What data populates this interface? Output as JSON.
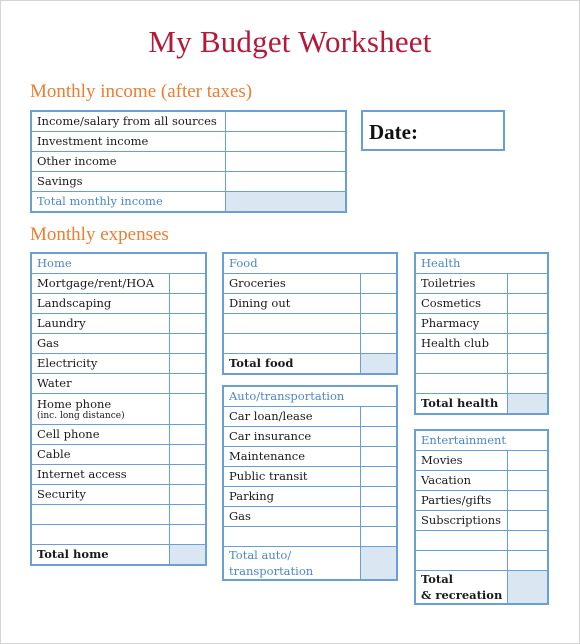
{
  "title": "My Budget Worksheet",
  "colors": {
    "title": "#b5193a",
    "section_heading": "#ee7d30",
    "table_border": "#6a9fd4",
    "category_header": "#4c86c6",
    "total_fill": "#dbe6f3"
  },
  "income": {
    "heading": "Monthly income (after taxes)",
    "rows": [
      {
        "label": "Income/salary from all sources",
        "value": ""
      },
      {
        "label": "Investment income",
        "value": ""
      },
      {
        "label": "Other income",
        "value": ""
      },
      {
        "label": "Savings",
        "value": ""
      }
    ],
    "total_label": "Total monthly income",
    "total_value": ""
  },
  "date": {
    "label": "Date:",
    "value": ""
  },
  "expenses": {
    "heading": "Monthly expenses",
    "home": {
      "header": "Home",
      "rows": [
        {
          "label": "Mortgage/rent/HOA",
          "value": ""
        },
        {
          "label": "Landscaping",
          "value": ""
        },
        {
          "label": "Laundry",
          "value": ""
        },
        {
          "label": "Gas",
          "value": ""
        },
        {
          "label": "Electricity",
          "value": ""
        },
        {
          "label": "Water",
          "value": ""
        },
        {
          "label": "Home phone",
          "note": "(inc. long distance)",
          "value": ""
        },
        {
          "label": "Cell phone",
          "value": ""
        },
        {
          "label": "Cable",
          "value": ""
        },
        {
          "label": "Internet access",
          "value": ""
        },
        {
          "label": "Security",
          "value": ""
        },
        {
          "label": "",
          "value": ""
        },
        {
          "label": "",
          "value": ""
        }
      ],
      "total_label": "Total home",
      "total_value": ""
    },
    "food": {
      "header": "Food",
      "rows": [
        {
          "label": "Groceries",
          "value": ""
        },
        {
          "label": "Dining out",
          "value": ""
        },
        {
          "label": "",
          "value": ""
        },
        {
          "label": "",
          "value": ""
        }
      ],
      "total_label": "Total food",
      "total_value": ""
    },
    "auto": {
      "header": "Auto/transportation",
      "rows": [
        {
          "label": "Car loan/lease",
          "value": ""
        },
        {
          "label": "Car insurance",
          "value": ""
        },
        {
          "label": "Maintenance",
          "value": ""
        },
        {
          "label": "Public transit",
          "value": ""
        },
        {
          "label": "Parking",
          "value": ""
        },
        {
          "label": "Gas",
          "value": ""
        },
        {
          "label": "",
          "value": ""
        }
      ],
      "total_label_line1": "Total auto/",
      "total_label_line2": "transportation",
      "total_value": ""
    },
    "health": {
      "header": "Health",
      "rows": [
        {
          "label": "Toiletries",
          "value": ""
        },
        {
          "label": "Cosmetics",
          "value": ""
        },
        {
          "label": "Pharmacy",
          "value": ""
        },
        {
          "label": "Health club",
          "value": ""
        },
        {
          "label": "",
          "value": ""
        },
        {
          "label": "",
          "value": ""
        }
      ],
      "total_label": "Total health",
      "total_value": ""
    },
    "entertainment": {
      "header": "Entertainment",
      "rows": [
        {
          "label": "Movies",
          "value": ""
        },
        {
          "label": "Vacation",
          "value": ""
        },
        {
          "label": "Parties/gifts",
          "value": ""
        },
        {
          "label": "Subscriptions",
          "value": ""
        },
        {
          "label": "",
          "value": ""
        },
        {
          "label": "",
          "value": ""
        }
      ],
      "total_label_line1": "Total",
      "total_label_line2": "& recreation",
      "total_value": ""
    }
  }
}
